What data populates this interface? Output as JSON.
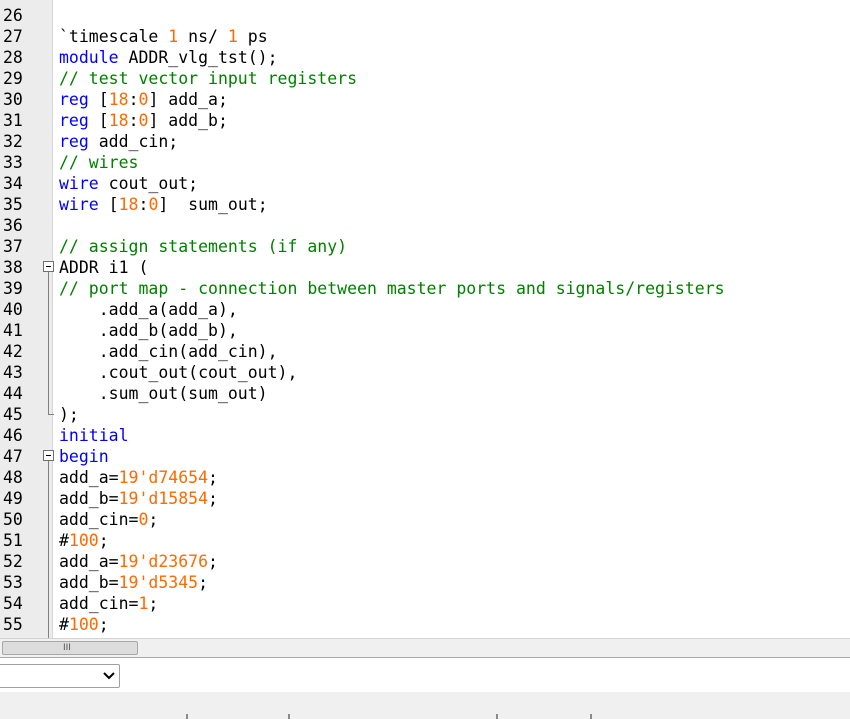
{
  "editor": {
    "lines": [
      {
        "n": "26",
        "parts": []
      },
      {
        "n": "27",
        "parts": [
          {
            "t": "tx",
            "s": "`timescale "
          },
          {
            "t": "num",
            "s": "1"
          },
          {
            "t": "tx",
            "s": " ns/ "
          },
          {
            "t": "num",
            "s": "1"
          },
          {
            "t": "tx",
            "s": " ps"
          }
        ]
      },
      {
        "n": "28",
        "parts": [
          {
            "t": "kw",
            "s": "module"
          },
          {
            "t": "tx",
            "s": " ADDR_vlg_tst();"
          }
        ]
      },
      {
        "n": "29",
        "parts": [
          {
            "t": "cm",
            "s": "// test vector input registers"
          }
        ]
      },
      {
        "n": "30",
        "parts": [
          {
            "t": "kw",
            "s": "reg"
          },
          {
            "t": "tx",
            "s": " ["
          },
          {
            "t": "num",
            "s": "18"
          },
          {
            "t": "tx",
            "s": ":"
          },
          {
            "t": "num",
            "s": "0"
          },
          {
            "t": "tx",
            "s": "] add_a;"
          }
        ]
      },
      {
        "n": "31",
        "parts": [
          {
            "t": "kw",
            "s": "reg"
          },
          {
            "t": "tx",
            "s": " ["
          },
          {
            "t": "num",
            "s": "18"
          },
          {
            "t": "tx",
            "s": ":"
          },
          {
            "t": "num",
            "s": "0"
          },
          {
            "t": "tx",
            "s": "] add_b;"
          }
        ]
      },
      {
        "n": "32",
        "parts": [
          {
            "t": "kw",
            "s": "reg"
          },
          {
            "t": "tx",
            "s": " add_cin;"
          }
        ]
      },
      {
        "n": "33",
        "parts": [
          {
            "t": "cm",
            "s": "// wires"
          }
        ]
      },
      {
        "n": "34",
        "parts": [
          {
            "t": "kw",
            "s": "wire"
          },
          {
            "t": "tx",
            "s": " cout_out;"
          }
        ]
      },
      {
        "n": "35",
        "parts": [
          {
            "t": "kw",
            "s": "wire"
          },
          {
            "t": "tx",
            "s": " ["
          },
          {
            "t": "num",
            "s": "18"
          },
          {
            "t": "tx",
            "s": ":"
          },
          {
            "t": "num",
            "s": "0"
          },
          {
            "t": "tx",
            "s": "]  sum_out;"
          }
        ]
      },
      {
        "n": "36",
        "parts": []
      },
      {
        "n": "37",
        "parts": [
          {
            "t": "cm",
            "s": "// assign statements (if any)"
          }
        ]
      },
      {
        "n": "38",
        "fold": true,
        "parts": [
          {
            "t": "tx",
            "s": "ADDR i1 ("
          }
        ]
      },
      {
        "n": "39",
        "parts": [
          {
            "t": "cm",
            "s": "// port map - connection between master ports and signals/registers"
          }
        ]
      },
      {
        "n": "40",
        "parts": [
          {
            "t": "tx",
            "s": "    .add_a(add_a),"
          }
        ]
      },
      {
        "n": "41",
        "parts": [
          {
            "t": "tx",
            "s": "    .add_b(add_b),"
          }
        ]
      },
      {
        "n": "42",
        "parts": [
          {
            "t": "tx",
            "s": "    .add_cin(add_cin),"
          }
        ]
      },
      {
        "n": "43",
        "parts": [
          {
            "t": "tx",
            "s": "    .cout_out(cout_out),"
          }
        ]
      },
      {
        "n": "44",
        "parts": [
          {
            "t": "tx",
            "s": "    .sum_out(sum_out)"
          }
        ]
      },
      {
        "n": "45",
        "parts": [
          {
            "t": "tx",
            "s": ");"
          }
        ]
      },
      {
        "n": "46",
        "parts": [
          {
            "t": "kw",
            "s": "initial"
          }
        ]
      },
      {
        "n": "47",
        "fold": true,
        "parts": [
          {
            "t": "kw",
            "s": "begin"
          }
        ]
      },
      {
        "n": "48",
        "parts": [
          {
            "t": "tx",
            "s": "add_a="
          },
          {
            "t": "num",
            "s": "19'd74654"
          },
          {
            "t": "tx",
            "s": ";"
          }
        ]
      },
      {
        "n": "49",
        "parts": [
          {
            "t": "tx",
            "s": "add_b="
          },
          {
            "t": "num",
            "s": "19'd15854"
          },
          {
            "t": "tx",
            "s": ";"
          }
        ]
      },
      {
        "n": "50",
        "parts": [
          {
            "t": "tx",
            "s": "add_cin="
          },
          {
            "t": "num",
            "s": "0"
          },
          {
            "t": "tx",
            "s": ";"
          }
        ]
      },
      {
        "n": "51",
        "parts": [
          {
            "t": "tx",
            "s": "#"
          },
          {
            "t": "num",
            "s": "100"
          },
          {
            "t": "tx",
            "s": ";"
          }
        ]
      },
      {
        "n": "52",
        "parts": [
          {
            "t": "tx",
            "s": "add_a="
          },
          {
            "t": "num",
            "s": "19'd23676"
          },
          {
            "t": "tx",
            "s": ";"
          }
        ]
      },
      {
        "n": "53",
        "parts": [
          {
            "t": "tx",
            "s": "add_b="
          },
          {
            "t": "num",
            "s": "19'd5345"
          },
          {
            "t": "tx",
            "s": ";"
          }
        ]
      },
      {
        "n": "54",
        "parts": [
          {
            "t": "tx",
            "s": "add_cin="
          },
          {
            "t": "num",
            "s": "1"
          },
          {
            "t": "tx",
            "s": ";"
          }
        ]
      },
      {
        "n": "55",
        "parts": [
          {
            "t": "tx",
            "s": "#"
          },
          {
            "t": "num",
            "s": "100"
          },
          {
            "t": "tx",
            "s": ";"
          }
        ]
      }
    ]
  },
  "scrollbar": {
    "thumb_grip": "III"
  },
  "panel": {
    "dropdown_value": ""
  },
  "colors": {
    "keyword": "#0000ff",
    "comment": "#008000",
    "number": "#ff6a00",
    "text": "#000000"
  },
  "icons": {
    "dropdown": "chevron-down-icon",
    "fold": "fold-minus-icon"
  }
}
